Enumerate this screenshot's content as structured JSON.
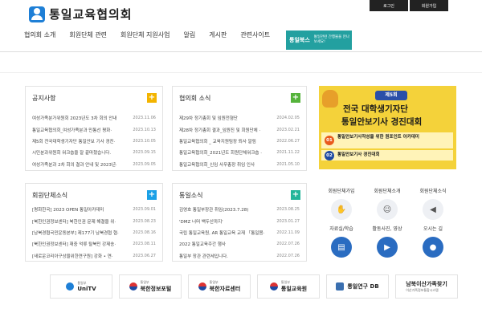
{
  "header": {
    "site_name": "통일교육협의회",
    "login": "로그인",
    "join": "회원가입",
    "nav": [
      "협의회 소개",
      "회원단체 관련",
      "회원단체 지원사업",
      "알림",
      "게시판",
      "관련사이트"
    ],
    "unibook": {
      "label": "통일북스",
      "desc": "통일관련 간행물을 만나보세요!"
    }
  },
  "notice": {
    "title": "공지사항",
    "items": [
      {
        "t": "여성가족분가위원회 2023년도 3차 회의 안내",
        "d": "2023.11.06"
      },
      {
        "t": "통일교육협의회_여성가족분과 민통선 평화·",
        "d": "2023.10.13"
      },
      {
        "t": "제5회 전국대학생기자단 통일안보 기사 경진·",
        "d": "2023.10.05"
      },
      {
        "t": "시민분과위원회 워크숍을 잘 끝마쳤습니다.",
        "d": "2023.09.15"
      },
      {
        "t": "여성가족분과 2차 회의 결과 안내 및 2023년·",
        "d": "2023.09.05"
      }
    ]
  },
  "council": {
    "title": "협의회 소식",
    "items": [
      {
        "t": "제29차 정기총회 및 임원전형단",
        "d": "2024.02.05"
      },
      {
        "t": "제28차 정기총회 결과_임원진 및 회원단체 ·",
        "d": "2023.02.21"
      },
      {
        "t": "통일교육협의회 _ 교육지원팀장 퇴사 알림",
        "d": "2022.06.27"
      },
      {
        "t": "통일교육협의회_2021년도 회원단체워크숍 ·",
        "d": "2021.11.22"
      },
      {
        "t": "통일교육협의회_신임 사무총장 취임 인사",
        "d": "2021.05.10"
      }
    ]
  },
  "member": {
    "title": "회원단체소식",
    "items": [
      {
        "t": "[평화한국] 2023 OPEN 통일아카데미",
        "d": "2023.09.01"
      },
      {
        "t": "[북한인권정보센터] 북한인권 문제 해결을 위·",
        "d": "2023.08.23"
      },
      {
        "t": "[남북경협국민운동본부] 제177기 남북경협 협·",
        "d": "2023.08.16"
      },
      {
        "t": "[북한인권정보센터] 재중 억류 탈북민 강제송·",
        "d": "2023.08.11"
      },
      {
        "t": "[새로운코리아구상을위한연구원] 강화 • 연·",
        "d": "2023.06.27"
      }
    ]
  },
  "unification": {
    "title": "통일소식",
    "items": [
      {
        "t": "김영호 통일부장관 취임(2023.7.28)",
        "d": "2023.08.25"
      },
      {
        "t": "'DMZ 너머 백두산까지'",
        "d": "2023.01.27"
      },
      {
        "t": "국립 통일교육원, AR 통일교육 교재 「통일봄·",
        "d": "2022.11.09"
      },
      {
        "t": "2022 통일교육주간 행사",
        "d": "2022.07.26"
      },
      {
        "t": "통일부 장관 관련세입니다.",
        "d": "2022.07.26"
      }
    ]
  },
  "banner": {
    "tag": "제5회",
    "line1": "전국 대학생기자단",
    "line2": "통일안보기사 경진대회",
    "item1": "통일안보기사작성을 위한 원포인트 아카데미",
    "item2": "통일안보기사 경진대회",
    "n1": "01",
    "n2": "02"
  },
  "quick": [
    {
      "label": "회원단체가입",
      "icon": "handshake-icon",
      "glyph": "✋"
    },
    {
      "label": "회원단체소개",
      "icon": "people-icon",
      "glyph": "👥"
    },
    {
      "label": "회원단체소식",
      "icon": "megaphone-icon",
      "glyph": "📢"
    },
    {
      "label": "자료실/학습",
      "icon": "book-icon",
      "glyph": "📖"
    },
    {
      "label": "활동사진, 영상",
      "icon": "camera-icon",
      "glyph": "▶"
    },
    {
      "label": "오시는 길",
      "icon": "map-pin-icon",
      "glyph": "●"
    }
  ],
  "partners": [
    {
      "name": "UniTV",
      "sub": "통일부"
    },
    {
      "name": "북한정보포털",
      "sub": "통일부"
    },
    {
      "name": "북한자료센터",
      "sub": "통일부"
    },
    {
      "name": "통일교육원",
      "sub": "통일부"
    },
    {
      "name": "통일연구 DB",
      "sub": ""
    },
    {
      "name": "남북이산가족찾기",
      "sub": "이산가족정보통합시스템"
    }
  ]
}
